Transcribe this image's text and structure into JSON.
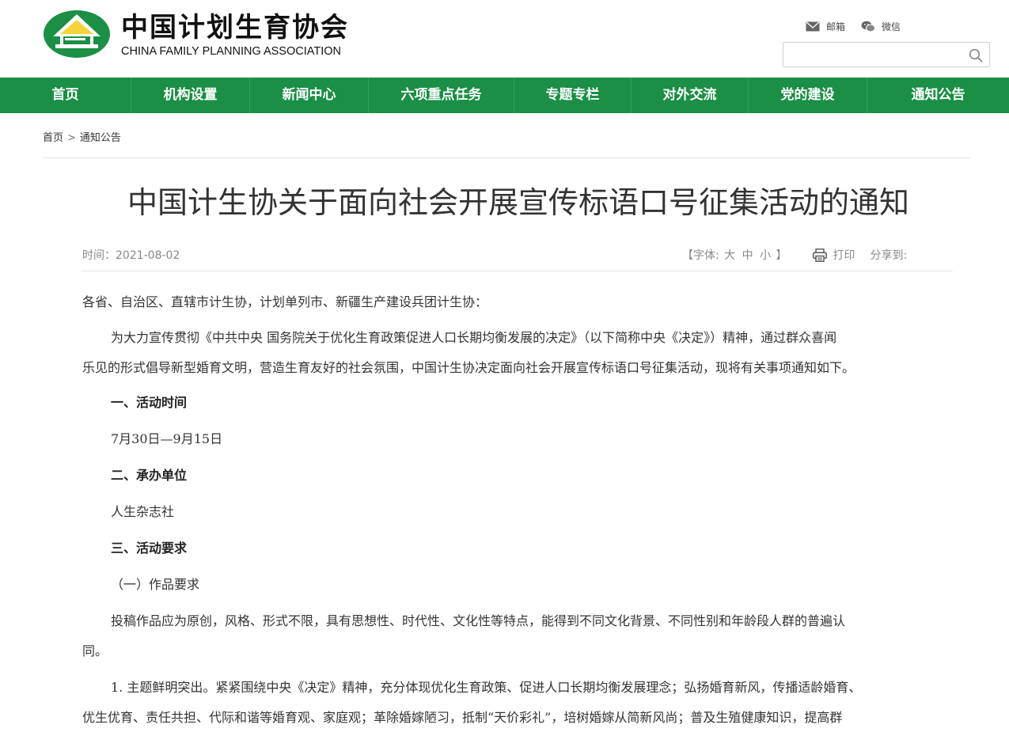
{
  "header": {
    "logo_cn": "中国计划生育协会",
    "logo_en": "CHINA FAMILY PLANNING ASSOCIATION",
    "links": [
      {
        "label": "邮箱",
        "icon": "mail-icon"
      },
      {
        "label": "微信",
        "icon": "wechat-icon"
      }
    ],
    "search": {
      "placeholder": "",
      "icon": "search-icon"
    }
  },
  "nav": {
    "items": [
      "首页",
      "机构设置",
      "新闻中心",
      "六项重点任务",
      "专题专栏",
      "对外交流",
      "党的建设",
      "通知公告"
    ]
  },
  "breadcrumb": {
    "home": "首页",
    "separator": ">",
    "current": "通知公告"
  },
  "article": {
    "title": "中国计生协关于面向社会开展宣传标语口号征集活动的通知",
    "time": "时间：2021-08-02",
    "font_label_open": "【字体:",
    "font_sizes": [
      "大",
      "中",
      "小"
    ],
    "font_label_close": "】",
    "print_label": "打印",
    "share_label": "分享到:",
    "paragraphs": [
      "各省、自治区、直辖市计生协，计划单列市、新疆生产建设兵团计生协：",
      "为大力宣传贯彻《中共中央 国务院关于优化生育政策促进人口长期均衡发展的决定》（以下简称中央《决定》）精神，通过群众喜闻",
      "乐见的形式倡导新型婚育文明，营造生育友好的社会氛围，中国计生协决定面向社会开展宣传标语口号征集活动，现将有关事项通知如下。",
      "一、活动时间",
      "7月30日—9月15日",
      "二、承办单位",
      "人生杂志社",
      "三、活动要求",
      "（一）作品要求",
      "投稿作品应为原创，风格、形式不限，具有思想性、时代性、文化性等特点，能得到不同文化背景、不同性别和年龄段人群的普遍认",
      "同。",
      "1. 主题鲜明突出。紧紧围绕中央《决定》精神，充分体现优化生育政策、促进人口长期均衡发展理念；弘扬婚育新风，传播适龄婚育、",
      "优生优育、责任共担、代际和谐等婚育观、家庭观；革除婚嫁陋习，抵制“天价彩礼”，培树婚嫁从简新风尚；普及生殖健康知识，提高群"
    ]
  },
  "colors": {
    "nav_green": "#1a8f45",
    "logo_green": "#1a8f45",
    "logo_yellow": "#f5d33b"
  }
}
